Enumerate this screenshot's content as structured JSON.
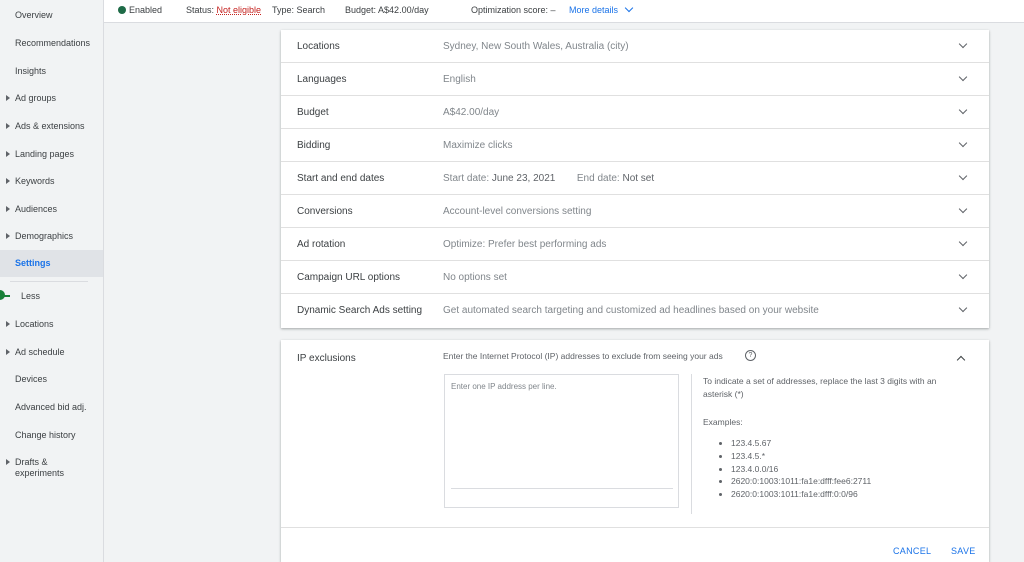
{
  "sidebar": {
    "items": [
      {
        "label": "Overview",
        "caret": false,
        "active": false
      },
      {
        "label": "Recommendations",
        "caret": false,
        "active": false
      },
      {
        "label": "Insights",
        "caret": false,
        "active": false
      },
      {
        "label": "Ad groups",
        "caret": true,
        "active": false
      },
      {
        "label": "Ads & extensions",
        "caret": true,
        "active": false
      },
      {
        "label": "Landing pages",
        "caret": true,
        "active": false
      },
      {
        "label": "Keywords",
        "caret": true,
        "active": false
      },
      {
        "label": "Audiences",
        "caret": true,
        "active": false
      },
      {
        "label": "Demographics",
        "caret": true,
        "active": false
      },
      {
        "label": "Settings",
        "caret": false,
        "active": true
      },
      {
        "label": "Locations",
        "caret": true,
        "active": false
      },
      {
        "label": "Ad schedule",
        "caret": true,
        "active": false
      },
      {
        "label": "Devices",
        "caret": false,
        "active": false
      },
      {
        "label": "Advanced bid adj.",
        "caret": false,
        "active": false
      },
      {
        "label": "Change history",
        "caret": false,
        "active": false
      },
      {
        "label": "Drafts & experiments",
        "caret": true,
        "active": false
      }
    ],
    "less_label": "Less"
  },
  "topbar": {
    "status": "Enabled",
    "status_label": "Status:",
    "status_value": "Not eligible",
    "type_label": "Type:",
    "type_value": "Search",
    "budget_label": "Budget:",
    "budget_value": "A$42.00/day",
    "opt_label": "Optimization score:",
    "opt_value": "–",
    "more_details": "More details"
  },
  "settings": {
    "rows": [
      {
        "label": "Locations",
        "value": "Sydney, New South Wales, Australia (city)"
      },
      {
        "label": "Languages",
        "value": "English"
      },
      {
        "label": "Budget",
        "value": "A$42.00/day"
      },
      {
        "label": "Bidding",
        "value": "Maximize clicks"
      },
      {
        "label": "Start and end dates",
        "start_label": "Start date:",
        "start_value": "June 23, 2021",
        "end_label": "End date:",
        "end_value": "Not set"
      },
      {
        "label": "Conversions",
        "value": "Account-level conversions setting"
      },
      {
        "label": "Ad rotation",
        "value": "Optimize: Prefer best performing ads"
      },
      {
        "label": "Campaign URL options",
        "value": "No options set"
      },
      {
        "label": "Dynamic Search Ads setting",
        "value": "Get automated search targeting and customized ad headlines based on your website"
      }
    ]
  },
  "ip_exclusions": {
    "title": "IP exclusions",
    "description": "Enter the Internet Protocol (IP) addresses to exclude from seeing your ads",
    "help_glyph": "?",
    "placeholder": "Enter one IP address per line.",
    "hint": "To indicate a set of addresses, replace the last 3 digits with an asterisk (*)",
    "examples_label": "Examples:",
    "examples": [
      "123.4.5.67",
      "123.4.5.*",
      "123.4.0.0/16",
      "2620:0:1003:1011:fa1e:dfff:fee6:2711",
      "2620:0:1003:1011:fa1e:dfff:0:0/96"
    ],
    "cancel": "CANCEL",
    "save": "SAVE"
  },
  "colors": {
    "accent": "#1a73e8",
    "enabled": "#1e6b47",
    "warning": "#c5221f",
    "less_marker": "#188038"
  }
}
